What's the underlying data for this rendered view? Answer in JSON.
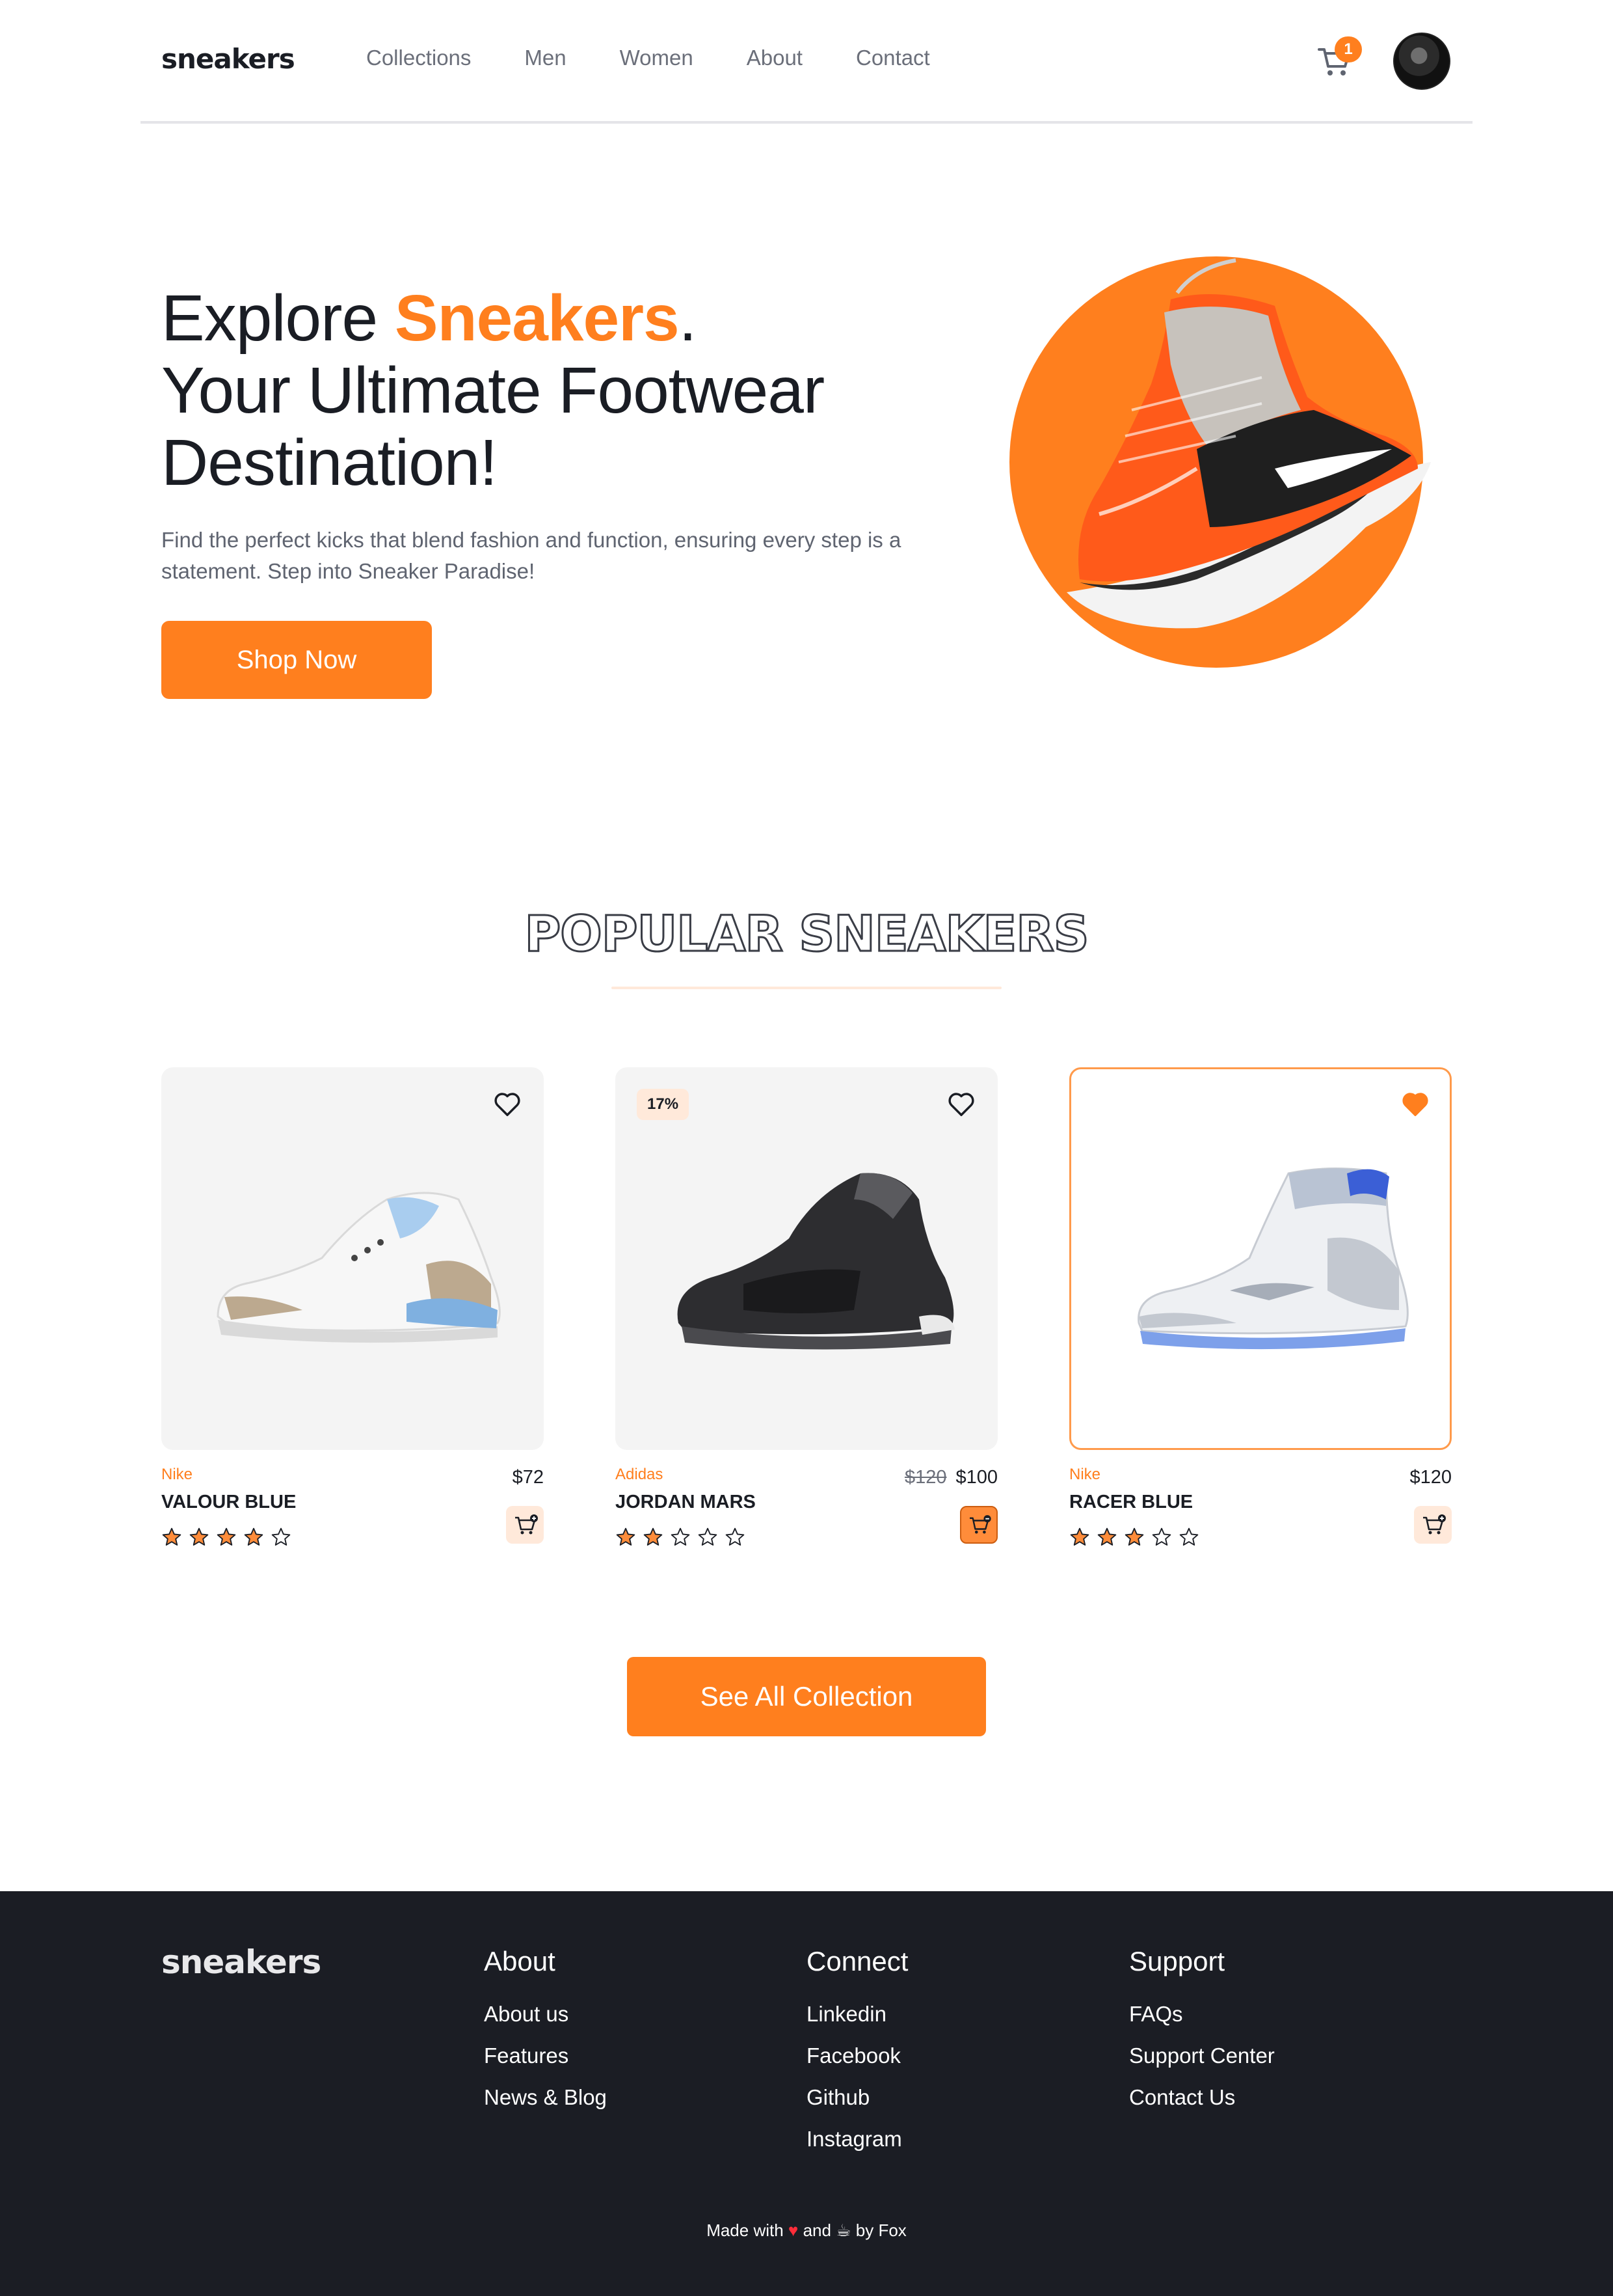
{
  "header": {
    "logo": "sneakers",
    "nav": [
      "Collections",
      "Men",
      "Women",
      "About",
      "Contact"
    ],
    "cart_count": "1"
  },
  "hero": {
    "title_part1": "Explore ",
    "title_accent": "Sneakers",
    "title_part2": ".",
    "title_line2": "Your Ultimate Footwear",
    "title_line3": "Destination!",
    "subtitle": "Find the perfect kicks that blend fashion and function, ensuring every step is a statement. Step into Sneaker Paradise!",
    "cta": "Shop Now"
  },
  "popular": {
    "title": "POPULAR SNEAKERS",
    "products": [
      {
        "brand": "Nike",
        "name": "VALOUR BLUE",
        "price": "$72",
        "old_price": "",
        "discount": "",
        "rating": 4,
        "favorite": false,
        "in_cart": false
      },
      {
        "brand": "Adidas",
        "name": "JORDAN MARS",
        "price": "$100",
        "old_price": "$120",
        "discount": "17%",
        "rating": 2,
        "favorite": false,
        "in_cart": true
      },
      {
        "brand": "Nike",
        "name": "RACER BLUE",
        "price": "$120",
        "old_price": "",
        "discount": "",
        "rating": 3,
        "favorite": true,
        "in_cart": false
      }
    ],
    "see_all": "See All Collection"
  },
  "footer": {
    "logo": "sneakers",
    "columns": [
      {
        "title": "About",
        "links": [
          "About us",
          "Features",
          "News & Blog"
        ]
      },
      {
        "title": "Connect",
        "links": [
          "Linkedin",
          "Facebook",
          "Github",
          "Instagram"
        ]
      },
      {
        "title": "Support",
        "links": [
          "FAQs",
          "Support Center",
          "Contact Us"
        ]
      }
    ],
    "made_with_1": "Made with",
    "made_with_2": "and",
    "made_with_3": "by Fox"
  },
  "colors": {
    "accent": "#ff7f1e",
    "dark": "#1b1d24",
    "muted": "#6b6f7a",
    "soft": "#ffe9da"
  },
  "icons": [
    "cart-icon",
    "avatar",
    "heart-icon",
    "star-icon",
    "add-to-cart-icon",
    "coffee-icon"
  ]
}
